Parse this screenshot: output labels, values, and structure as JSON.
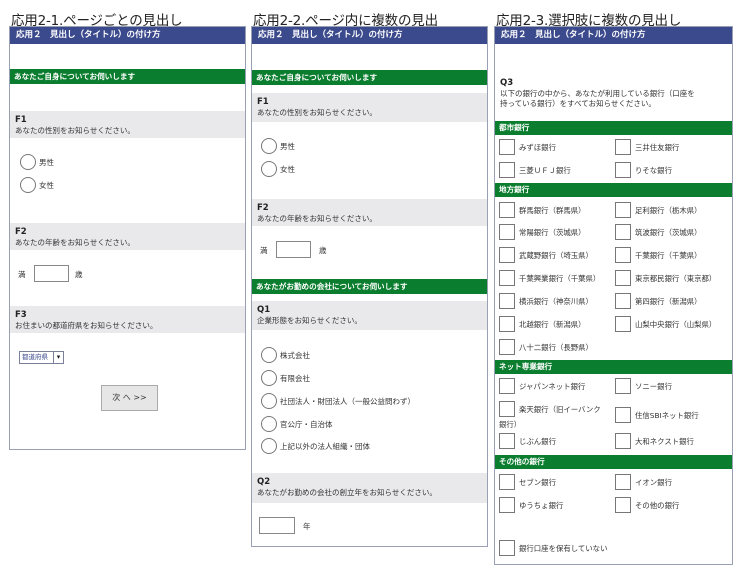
{
  "captions": {
    "c1": "応用2-1.ページごとの見出し",
    "c2": "応用2-2.ページ内に複数の見出",
    "c3": "応用2-3.選択肢に複数の見出し"
  },
  "header_title": "応用２　見出し（タイトル）の付け方",
  "p1": {
    "section": "あなたご自身についてお伺いします",
    "f1_id": "F1",
    "f1_text": "あなたの性別をお知らせください。",
    "male": "男性",
    "female": "女性",
    "f2_id": "F2",
    "f2_text": "あなたの年齢をお知らせください。",
    "age_prefix": "満",
    "age_suffix": "歳",
    "f3_id": "F3",
    "f3_text": "お住まいの都道府県をお知らせください。",
    "pref_select": "都道府県",
    "next": "次 へ >>"
  },
  "p2": {
    "section1": "あなたご自身についてお伺いします",
    "f1_id": "F1",
    "f1_text": "あなたの性別をお知らせください。",
    "male": "男性",
    "female": "女性",
    "f2_id": "F2",
    "f2_text": "あなたの年齢をお知らせください。",
    "age_prefix": "満",
    "age_suffix": "歳",
    "section2": "あなたがお勤めの会社についてお伺いします",
    "q1_id": "Q1",
    "q1_text": "企業形態をお知らせください。",
    "opt1": "株式会社",
    "opt2": "有限会社",
    "opt3": "社団法人・財団法人（一般公益問わず）",
    "opt4": "官公庁・自治体",
    "opt5": "上記以外の法人組織・団体",
    "q2_id": "Q2",
    "q2_text": "あなたがお勤めの会社の創立年をお知らせください。",
    "year_suffix": "年"
  },
  "p3": {
    "q3_id": "Q3",
    "q3_text_1": "以下の銀行の中から、あなたが利用している銀行（口座を",
    "q3_text_2": "持っている銀行）をすべてお知らせください。",
    "g1": "都市銀行",
    "g1_items": [
      "みずほ銀行",
      "三井住友銀行",
      "三菱ＵＦＪ銀行",
      "りそな銀行"
    ],
    "g2": "地方銀行",
    "g2_items": [
      "群馬銀行（群馬県）",
      "足利銀行（栃木県）",
      "常陽銀行（茨城県）",
      "筑波銀行（茨城県）",
      "武蔵野銀行（埼玉県）",
      "千葉銀行（千葉県）",
      "千葉興業銀行（千葉県）",
      "東京都民銀行（東京都）",
      "横浜銀行（神奈川県）",
      "第四銀行（新潟県）",
      "北越銀行（新潟県）",
      "山梨中央銀行（山梨県）",
      "八十二銀行（長野県）"
    ],
    "g3": "ネット専業銀行",
    "g3_items": [
      "ジャパンネット銀行",
      "ソニー銀行",
      "楽天銀行（旧イーバンク",
      "銀行）",
      "住信SBIネット銀行",
      "じぶん銀行",
      "大和ネクスト銀行"
    ],
    "g4": "その他の銀行",
    "g4_items": [
      "セブン銀行",
      "イオン銀行",
      "ゆうちょ銀行",
      "その他の銀行"
    ],
    "none": "銀行口座を保有していない"
  }
}
